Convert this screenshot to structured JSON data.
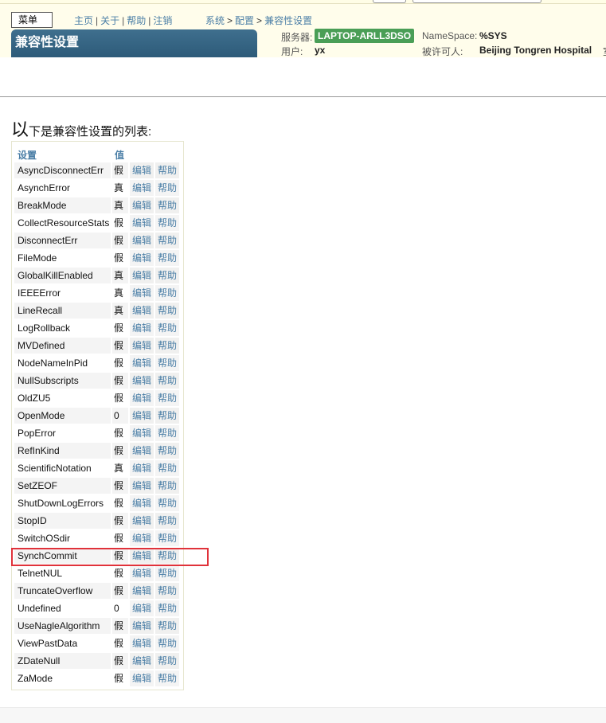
{
  "header": {
    "menu_label": "菜单",
    "nav": [
      "主页",
      "关于",
      "帮助",
      "注销"
    ],
    "breadcrumb": [
      "系统",
      "配置",
      "兼容性设置"
    ],
    "page_title": "兼容性设置",
    "server_label": "服务器:",
    "server_value": "LAPTOP-ARLL3DSO",
    "namespace_label": "NameSpace:",
    "namespace_value": "%SYS",
    "user_label": "用户:",
    "user_value": "yx",
    "licensee_label": "被许可人:",
    "licensee_value": "Beijing Tongren Hospital",
    "licensee_overflow": "室"
  },
  "intro": {
    "big": "以",
    "rest": "下是兼容性设置的列表:"
  },
  "table": {
    "headers": {
      "name": "设置",
      "value": "值"
    },
    "edit_label": "编辑",
    "help_label": "帮助",
    "rows": [
      {
        "name": "AsyncDisconnectErr",
        "value": "假"
      },
      {
        "name": "AsynchError",
        "value": "真"
      },
      {
        "name": "BreakMode",
        "value": "真"
      },
      {
        "name": "CollectResourceStats",
        "value": "假"
      },
      {
        "name": "DisconnectErr",
        "value": "假"
      },
      {
        "name": "FileMode",
        "value": "假"
      },
      {
        "name": "GlobalKillEnabled",
        "value": "真"
      },
      {
        "name": "IEEEError",
        "value": "真"
      },
      {
        "name": "LineRecall",
        "value": "真"
      },
      {
        "name": "LogRollback",
        "value": "假"
      },
      {
        "name": "MVDefined",
        "value": "假"
      },
      {
        "name": "NodeNameInPid",
        "value": "假"
      },
      {
        "name": "NullSubscripts",
        "value": "假"
      },
      {
        "name": "OldZU5",
        "value": "假"
      },
      {
        "name": "OpenMode",
        "value": "0"
      },
      {
        "name": "PopError",
        "value": "假"
      },
      {
        "name": "RefInKind",
        "value": "假"
      },
      {
        "name": "ScientificNotation",
        "value": "真"
      },
      {
        "name": "SetZEOF",
        "value": "假"
      },
      {
        "name": "ShutDownLogErrors",
        "value": "假"
      },
      {
        "name": "StopID",
        "value": "假"
      },
      {
        "name": "SwitchOSdir",
        "value": "假"
      },
      {
        "name": "SynchCommit",
        "value": "假"
      },
      {
        "name": "TelnetNUL",
        "value": "假"
      },
      {
        "name": "TruncateOverflow",
        "value": "假"
      },
      {
        "name": "Undefined",
        "value": "0"
      },
      {
        "name": "UseNagleAlgorithm",
        "value": "假"
      },
      {
        "name": "ViewPastData",
        "value": "假"
      },
      {
        "name": "ZDateNull",
        "value": "假"
      },
      {
        "name": "ZaMode",
        "value": "假"
      }
    ]
  },
  "colors": {
    "header_bg": "#fffdeb",
    "title_tab": "#2d5b79",
    "server_badge": "#4a9e56",
    "link": "#4a7ea6",
    "highlight": "#e0323a"
  }
}
